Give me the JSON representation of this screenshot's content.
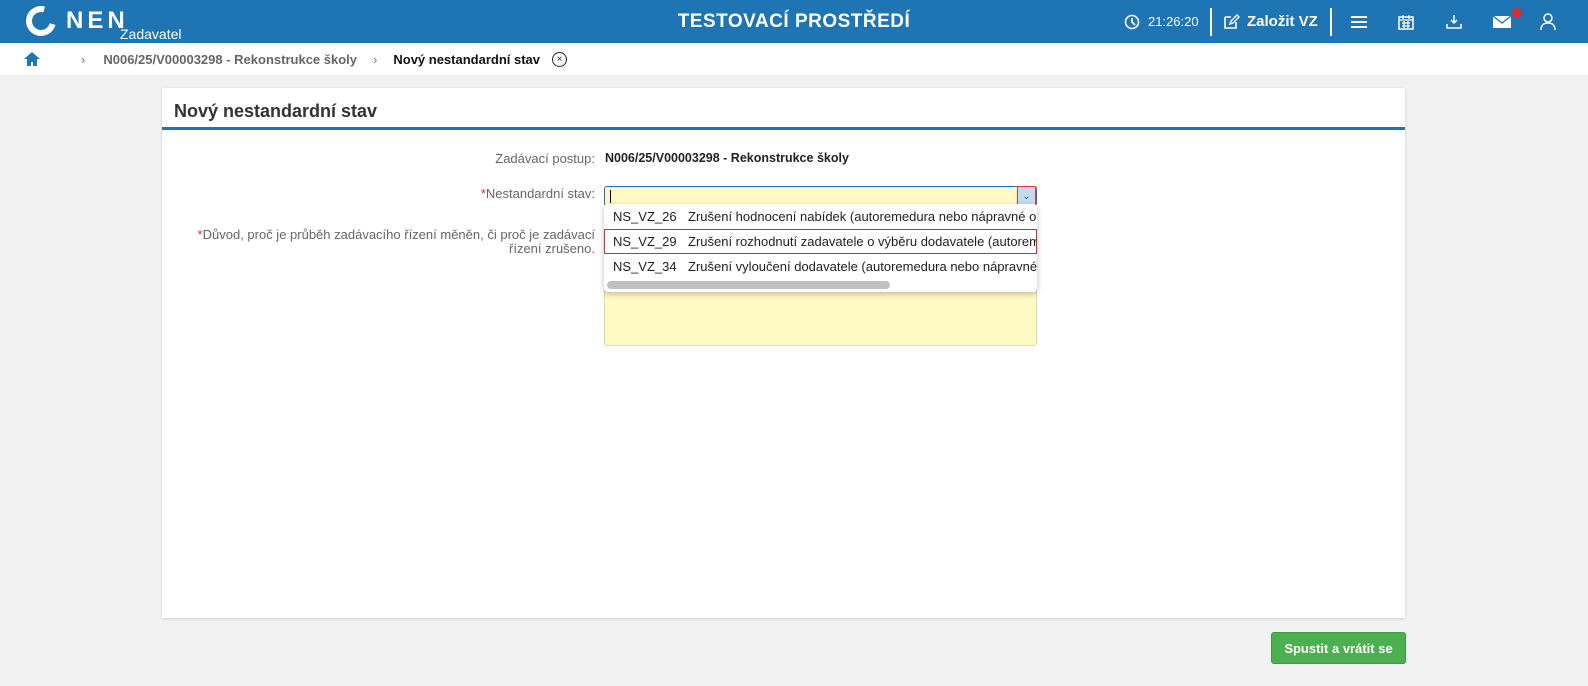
{
  "header": {
    "logo": "NEN",
    "subtitle": "Zadavatel",
    "env_title": "TESTOVACÍ PROSTŘEDÍ",
    "time": "21:26:20",
    "create_label": "Založit VZ",
    "notification_color": "#d32f2f"
  },
  "breadcrumb": {
    "items": [
      "N006/25/V00003298 - Rekonstrukce školy"
    ],
    "current": "Nový nestandardní stav"
  },
  "form": {
    "title": "Nový nestandardní stav",
    "procedure_label": "Zadávací postup:",
    "procedure_value": "N006/25/V00003298 - Rekonstrukce školy",
    "state_label": "Nestandardní stav:",
    "state_value": "",
    "reason_label": "Důvod, proč je průběh zadávacího řízení měněn, či proč je zadávací řízení zrušeno.",
    "options": [
      {
        "code": "NS_VZ_26",
        "text": "Zrušení hodnocení nabídek (autoremedura nebo nápravné op"
      },
      {
        "code": "NS_VZ_29",
        "text": "Zrušení rozhodnutí zadavatele o výběru dodavatele (autoreme"
      },
      {
        "code": "NS_VZ_34",
        "text": "Zrušení vyloučení dodavatele (autoremedura nebo nápravné o"
      }
    ]
  },
  "actions": {
    "submit": "Spustit a vrátit se"
  }
}
